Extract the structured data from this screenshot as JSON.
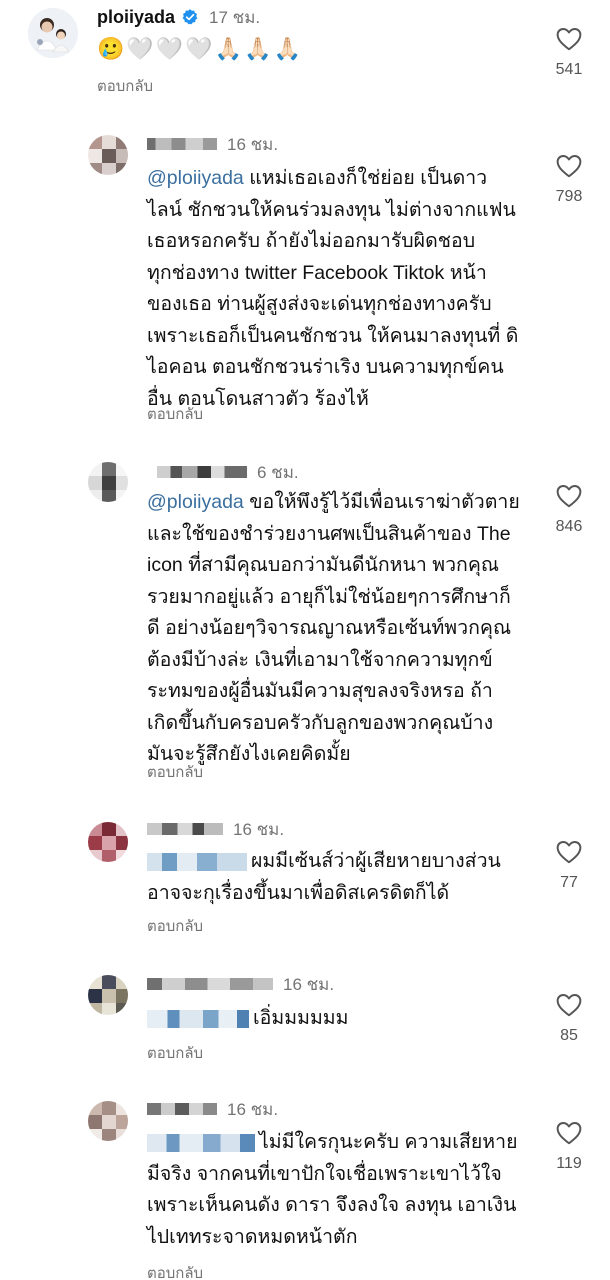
{
  "post_comment": {
    "username": "ploiiyada",
    "time": "17 ชม.",
    "emojis": [
      "🥲",
      "🤍",
      "🤍",
      "🤍",
      "🙏🏻",
      "🙏🏻",
      "🙏🏻"
    ],
    "reply_label": "ตอบกลับ",
    "likes": "541"
  },
  "comments": [
    {
      "time": "16 ชม.",
      "mention": "@ploiiyada",
      "text": " แหม่เธอเองก็ใช่ย่อย เป็นดาว\nไลน์ ชักชวนให้คนร่วมลงทุน ไม่ต่างจากแฟน\nเธอหรอกครับ ถ้ายังไม่ออกมารับผิดชอบ\nทุกช่องทาง twitter Facebook Tiktok หน้า\nของเธอ ท่านผู้สูงส่งจะเด่นทุกช่องทางครับ\nเพราะเธอก็เป็นคนชักชวน ให้คนมาลงทุนที่ ดิ\nไอคอน ตอนชักชวนร่าเริง บนความทุกข์คน\nอื่น ตอนโดนสาวตัว ร้องไห้",
      "reply_label": "ตอบกลับ",
      "likes": "798"
    },
    {
      "time": "6 ชม.",
      "mention": "@ploiiyada",
      "text": " ขอให้พึงรู้ไว้มีเพื่อนเราฆ่าตัวตาย\nและใช้ของชำร่วยงานศพเป็นสินค้าของ The\nicon ที่สามีคุณบอกว่ามันดีนักหนา พวกคุณ\nรวยมากอยู่แล้ว อายุก็ไม่ใช่น้อยๆการศึกษาก็\nดี อย่างน้อยๆวิจารณญาณหรือเซ้นท์พวกคุณ\nต้องมีบ้างล่ะ เงินที่เอามาใช้จากความทุกข์\nระทมของผู้อื่นมันมีความสุขลงจริงหรอ ถ้า\nเกิดขึ้นกับครอบครัวกับลูกของพวกคุณบ้าง\nมันจะรู้สึกยังไงเคยคิดมั้ย",
      "reply_label": "ตอบกลับ",
      "likes": "846"
    },
    {
      "time": "16 ชม.",
      "text": "ผมมีเซ้นส์ว่าผู้เสียหายบางส่วน\nอาจจะกุเรื่องขึ้นมาเพื่อดิสเครดิตก็ได้",
      "reply_label": "ตอบกลับ",
      "likes": "77"
    },
    {
      "time": "16 ชม.",
      "text": "เอิ่มมมมมม",
      "reply_label": "ตอบกลับ",
      "likes": "85"
    },
    {
      "time": "16 ชม.",
      "text": "ไม่มีใครกุนะครับ ความเสียหาย\nมีจริง จากคนที่เขาปักใจเชื่อเพราะเขาไว้ใจ\nเพราะเห็นคนดัง ดารา จึงลงใจ ลงทุน เอาเงิน\nไปเททระจาดหมดหน้าตัก",
      "reply_label": "ตอบกลับ",
      "likes": "119"
    }
  ],
  "icons": {
    "verified": "verified-badge-icon",
    "like": "heart-outline-icon"
  },
  "colors": {
    "mention": "#3b6f9f",
    "verified": "#1e90f0",
    "secondary_text": "#737373"
  }
}
